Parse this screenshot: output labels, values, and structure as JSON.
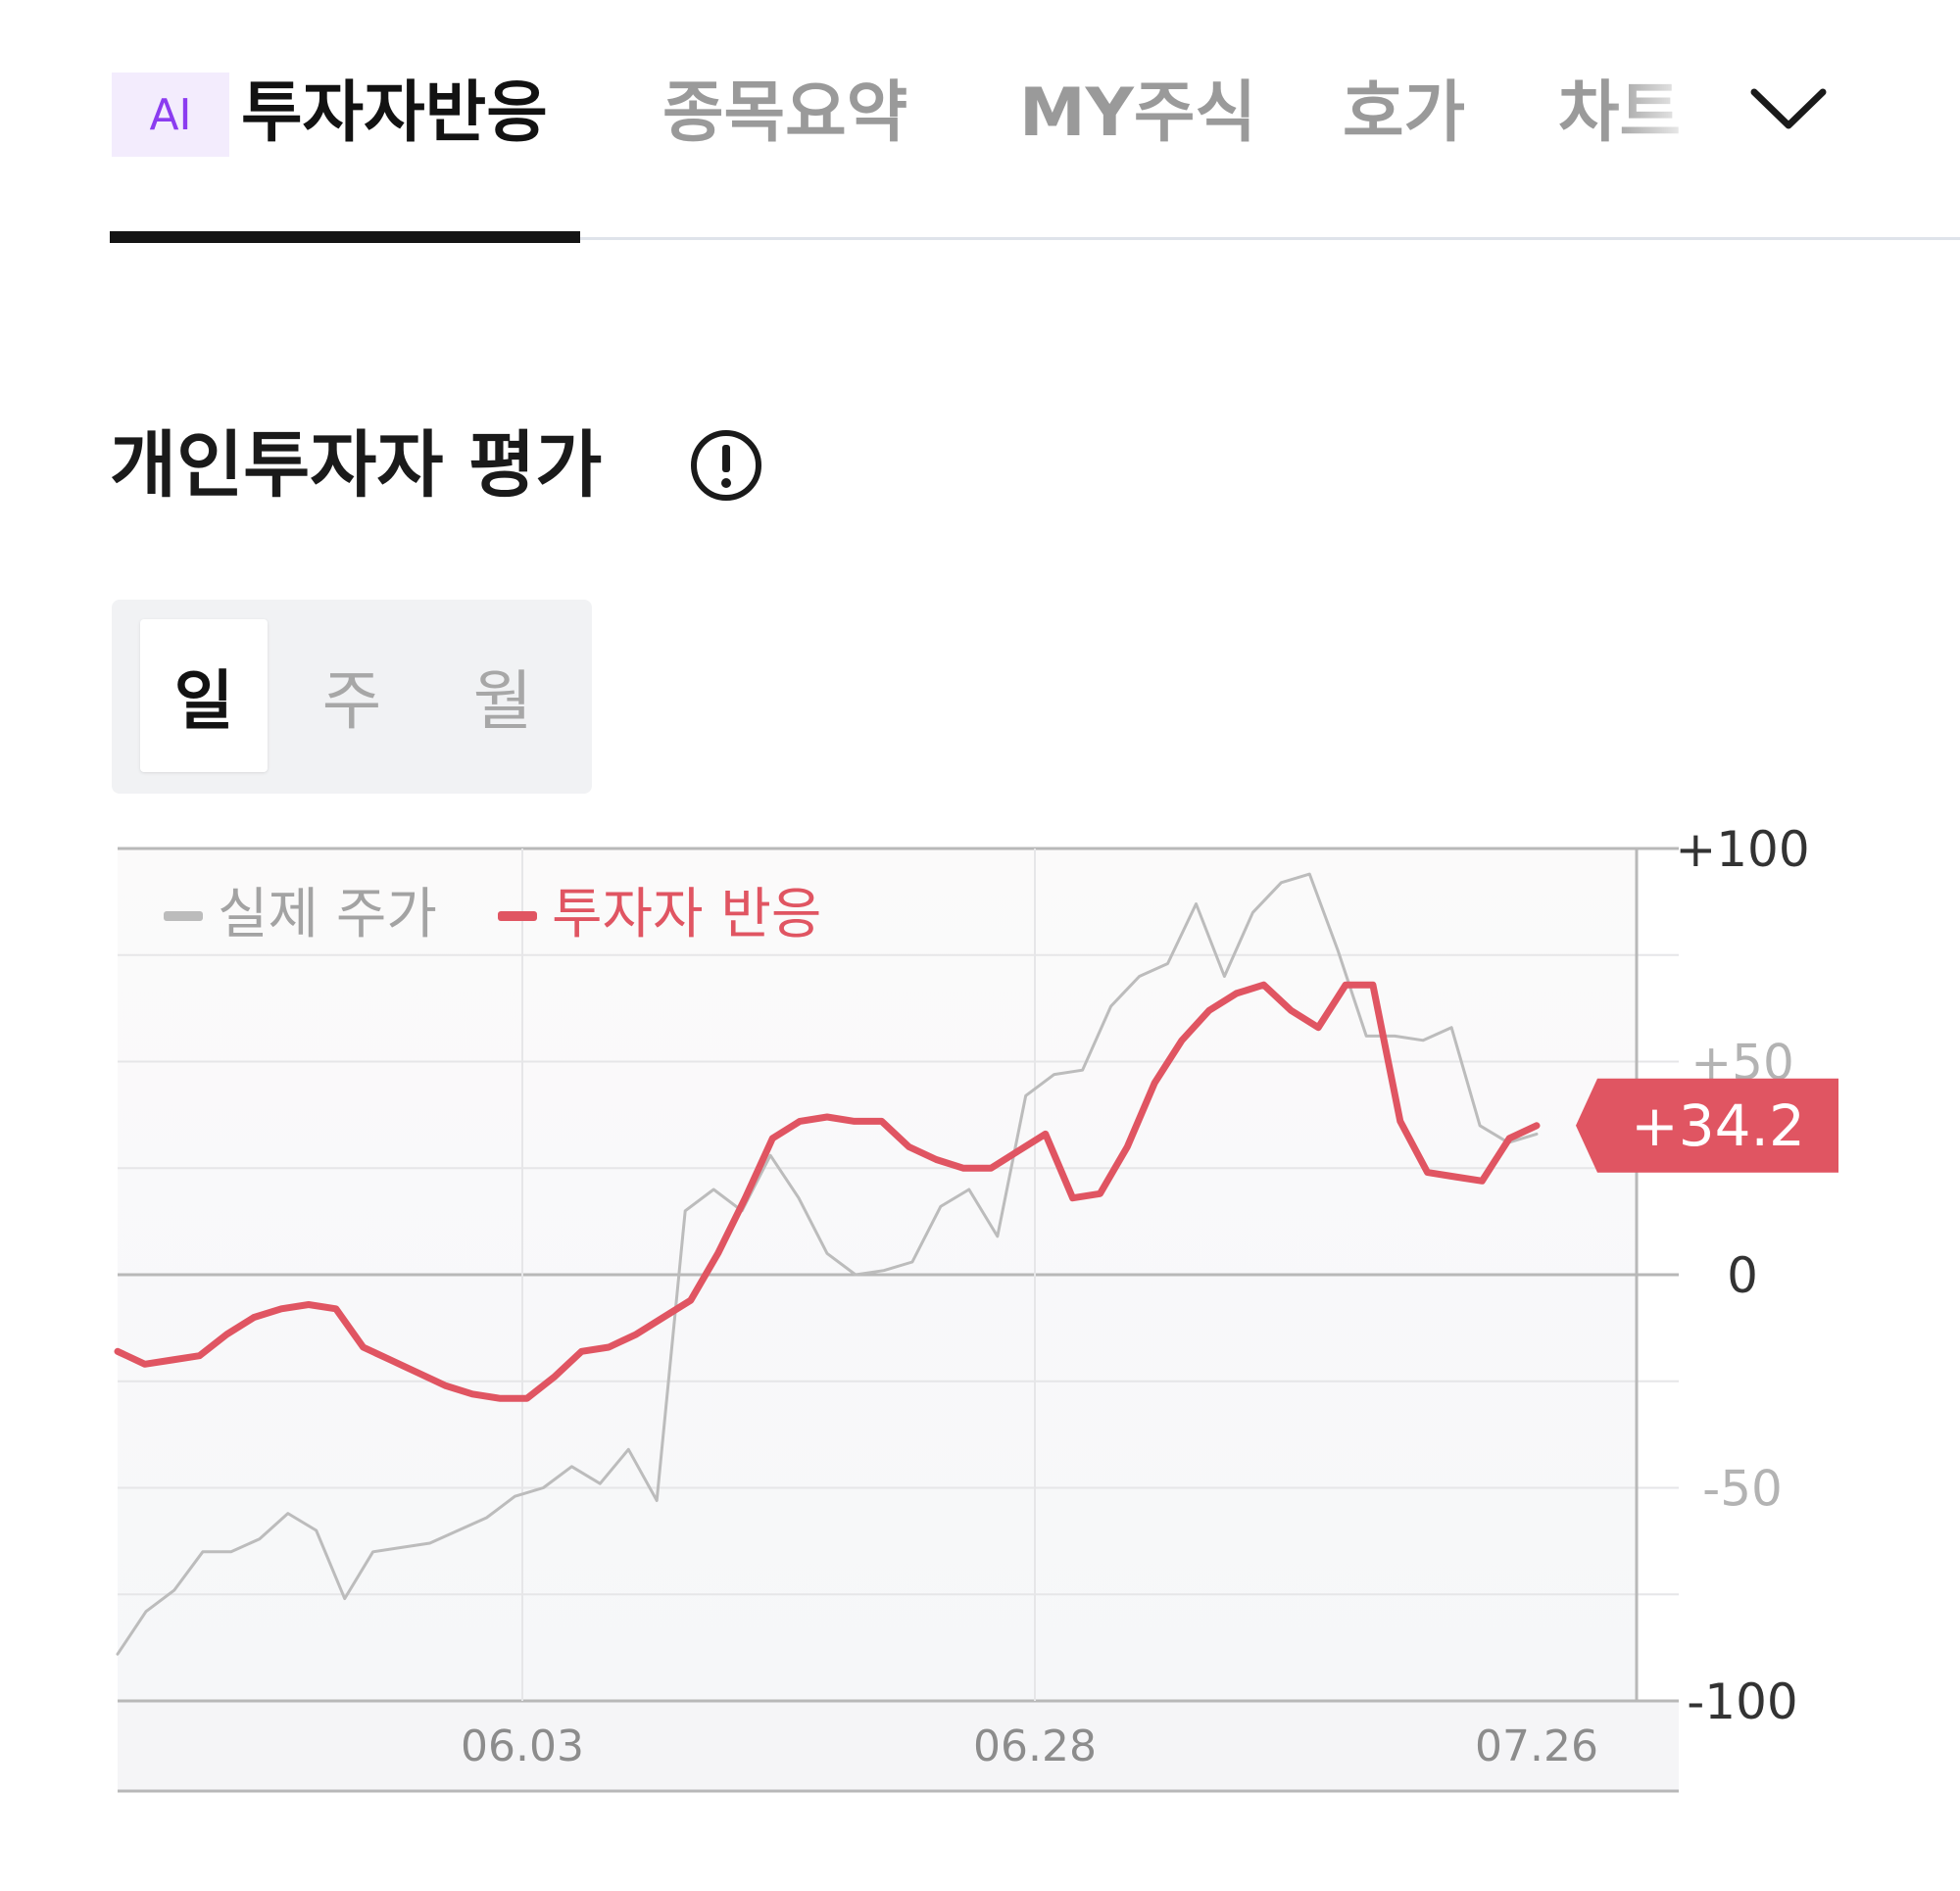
{
  "tabs": {
    "ai_badge": "AI",
    "items": [
      {
        "label": "투자자반응",
        "active": true
      },
      {
        "label": "종목요약",
        "active": false
      },
      {
        "label": "MY주식",
        "active": false
      },
      {
        "label": "호가",
        "active": false
      },
      {
        "label": "차트",
        "active": false
      }
    ],
    "more_icon": "chevron-down-icon"
  },
  "section": {
    "title": "개인투자자 평가",
    "info_icon": "info-exclamation-icon"
  },
  "period": {
    "options": [
      "일",
      "주",
      "월"
    ],
    "selected": "일"
  },
  "chart_data": {
    "type": "line",
    "ylim": [
      -100,
      100
    ],
    "y_ticks": [
      "+100",
      "+50",
      "0",
      "-50",
      "-100"
    ],
    "x_ticks": [
      "06.03",
      "06.28",
      "07.26"
    ],
    "legend_position": "top-left",
    "grid": true,
    "current_value_label": "+34.2",
    "colors": {
      "price": "#bcbcbc",
      "reaction": "#e05562",
      "badge": "#e05562"
    },
    "series": [
      {
        "name": "실제 주가",
        "values": [
          -89,
          -79,
          -74,
          -65,
          -65,
          -62,
          -56,
          -60,
          -76,
          -65,
          -64,
          -63,
          -60,
          -57,
          -52,
          -50,
          -45,
          -49,
          -41,
          -53,
          15,
          20,
          15,
          28,
          18,
          5,
          0,
          1,
          3,
          16,
          20,
          9,
          42,
          47,
          48,
          63,
          70,
          73,
          87,
          70,
          85,
          92,
          94,
          76,
          56,
          56,
          55,
          58,
          35,
          31,
          33
        ],
        "markers": {
          "legend": "gray-dash"
        }
      },
      {
        "name": "투자자 반응",
        "values": [
          -18,
          -21,
          -20,
          -19,
          -14,
          -10,
          -8,
          -7,
          -8,
          -17,
          -20,
          -23,
          -26,
          -28,
          -29,
          -29,
          -24,
          -18,
          -17,
          -14,
          -10,
          -6,
          5,
          18,
          32,
          36,
          37,
          36,
          36,
          30,
          27,
          25,
          25,
          29,
          33,
          18,
          19,
          30,
          45,
          55,
          62,
          66,
          68,
          62,
          58,
          68,
          68,
          36,
          24,
          23,
          22,
          32,
          35
        ],
        "markers": {
          "legend": "red-dash"
        }
      }
    ]
  }
}
